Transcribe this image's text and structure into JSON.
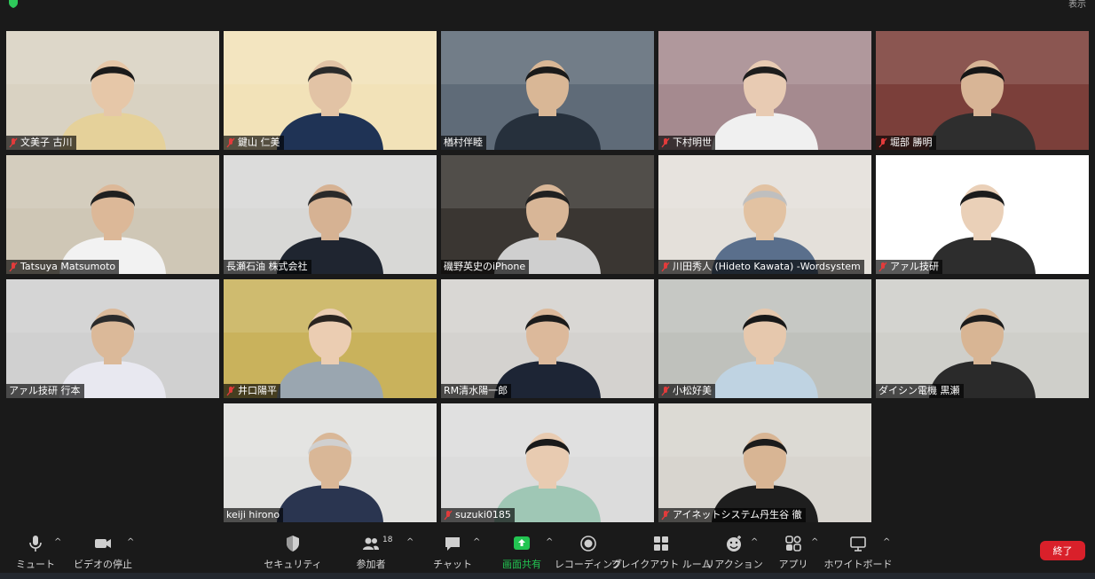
{
  "window": {
    "view_label": "表示"
  },
  "participants": [
    {
      "name": "文美子 古川",
      "muted": true,
      "bg": "#d9d2c2",
      "skin": "#e6c7a8",
      "hair": "#1b1b1b",
      "shirt": "#e5d19a"
    },
    {
      "name": "鍵山 仁美",
      "muted": true,
      "bg": "#f2e2b8",
      "skin": "#e2c3a5",
      "hair": "#2a2a2a",
      "shirt": "#1f3355"
    },
    {
      "name": "楢村伴睦",
      "muted": false,
      "bg": "#5f6b78",
      "skin": "#d9b796",
      "hair": "#1a1a1a",
      "shirt": "#26303c"
    },
    {
      "name": "下村明世",
      "muted": true,
      "bg": "#a58a8f",
      "skin": "#e8cbb3",
      "hair": "#1d1d1d",
      "shirt": "#f0f0f0"
    },
    {
      "name": "堀部 勝明",
      "muted": true,
      "bg": "#7b3f3a",
      "skin": "#d8b596",
      "hair": "#161616",
      "shirt": "#2e2e2e"
    },
    {
      "name": "Tatsuya Matsumoto",
      "muted": true,
      "bg": "#cfc7b6",
      "skin": "#dcb898",
      "hair": "#202020",
      "shirt": "#f2f2f2"
    },
    {
      "name": "長瀬石油 株式会社",
      "muted": false,
      "bg": "#d8d8d6",
      "skin": "#d6b293",
      "hair": "#2a2a2a",
      "shirt": "#1f2530"
    },
    {
      "name": "磯野英史のiPhone",
      "muted": false,
      "bg": "#3a3632",
      "skin": "#d8b697",
      "hair": "#202020",
      "shirt": "#cfcfcf"
    },
    {
      "name": "川田秀人 (Hideto Kawata) -Wordsystem",
      "muted": true,
      "bg": "#e4e0da",
      "skin": "#e2c2a2",
      "hair": "#bfbfbf",
      "shirt": "#5a6f8c"
    },
    {
      "name": "アァル技研",
      "muted": true,
      "bg": "#ffffff",
      "skin": "#ead0b8",
      "hair": "#1c1c1c",
      "shirt": "#2d2d2d"
    },
    {
      "name": "アァル技研 行本",
      "muted": false,
      "bg": "#d0d0d0",
      "skin": "#dbb999",
      "hair": "#2b2b2b",
      "shirt": "#e8e8f0"
    },
    {
      "name": "井口陽平",
      "muted": true,
      "bg": "#c9b25c",
      "skin": "#ebcdb2",
      "hair": "#2a2420",
      "shirt": "#9aa6b0"
    },
    {
      "name": "RM清水陽一郎",
      "muted": false,
      "bg": "#d4d2cf",
      "skin": "#dcb99b",
      "hair": "#1b1b1b",
      "shirt": "#1d2535",
      "active": true
    },
    {
      "name": "小松好美",
      "muted": true,
      "bg": "#bfc1bc",
      "skin": "#e6c8ad",
      "hair": "#181818",
      "shirt": "#bfd3e2"
    },
    {
      "name": "ダイシン電機 黒瀬",
      "muted": false,
      "bg": "#cfcfca",
      "skin": "#d8b594",
      "hair": "#1c1c1c",
      "shirt": "#2a2a2a"
    },
    {
      "name": "keiji hirono",
      "muted": false,
      "bg": "#e1e1df",
      "skin": "#d9b797",
      "hair": "#d0d0d0",
      "shirt": "#2a3550"
    },
    {
      "name": "suzuki0185",
      "muted": true,
      "bg": "#dcdcdc",
      "skin": "#e8cbb1",
      "hair": "#1a1a1a",
      "shirt": "#9fc7b5"
    },
    {
      "name": "アイネットシステム丹生谷 徹",
      "muted": true,
      "bg": "#d8d5cf",
      "skin": "#d8b594",
      "hair": "#1b1b1b",
      "shirt": "#1e1e1e"
    }
  ],
  "toolbar": {
    "mute": "ミュート",
    "stop_video": "ビデオの停止",
    "security": "セキュリティ",
    "participants": "参加者",
    "participants_count": "18",
    "chat": "チャット",
    "share_screen": "画面共有",
    "record": "レコーディング",
    "breakout": "ブレイクアウト ルーム",
    "reactions": "リアクション",
    "apps": "アプリ",
    "whiteboard": "ホワイトボード",
    "end": "終了"
  },
  "colors": {
    "share_green": "#23c552",
    "end_red": "#d9202a",
    "active_border": "#d8e66b"
  }
}
